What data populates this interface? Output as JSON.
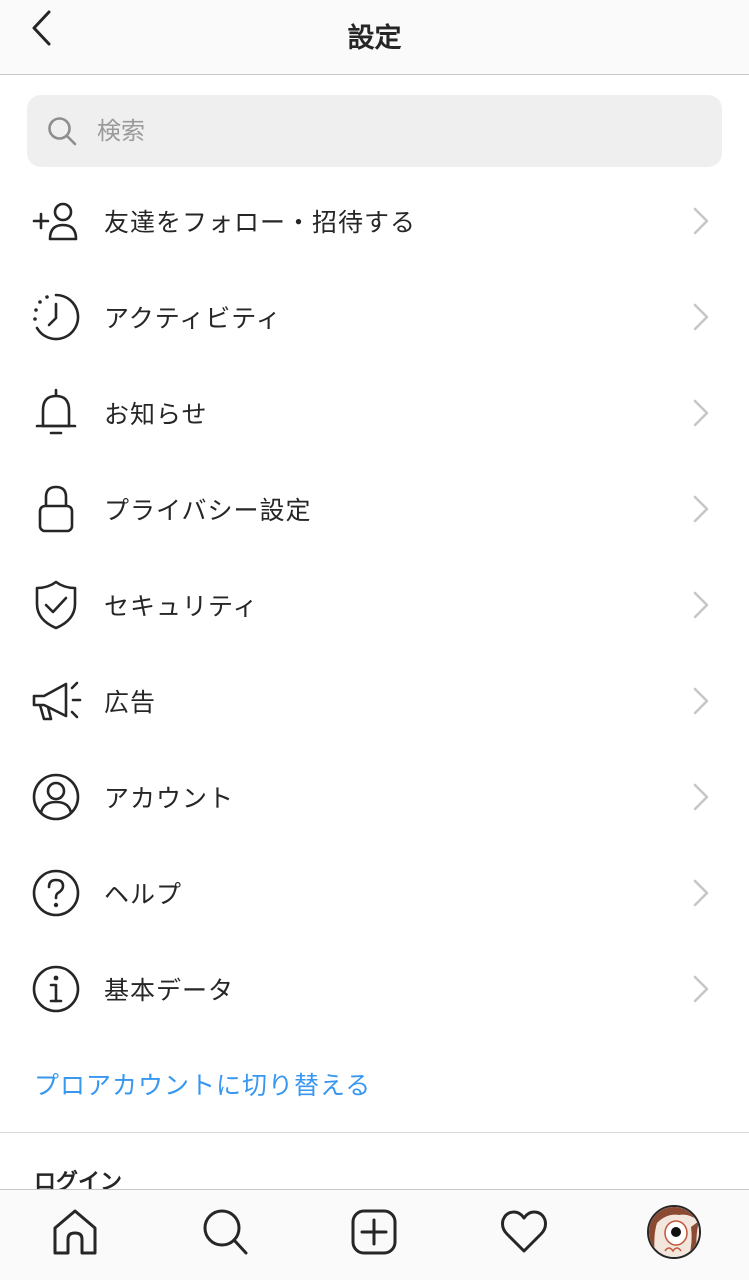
{
  "header": {
    "title": "設定",
    "back_icon": "chevron-left-icon"
  },
  "search": {
    "placeholder": "検索",
    "value": "",
    "icon": "search-icon"
  },
  "menu": [
    {
      "label": "友達をフォロー・招待する",
      "icon": "add-person-icon"
    },
    {
      "label": "アクティビティ",
      "icon": "activity-clock-icon"
    },
    {
      "label": "お知らせ",
      "icon": "bell-icon"
    },
    {
      "label": "プライバシー設定",
      "icon": "lock-icon"
    },
    {
      "label": "セキュリティ",
      "icon": "shield-check-icon"
    },
    {
      "label": "広告",
      "icon": "megaphone-icon"
    },
    {
      "label": "アカウント",
      "icon": "account-circle-icon"
    },
    {
      "label": "ヘルプ",
      "icon": "help-icon"
    },
    {
      "label": "基本データ",
      "icon": "info-icon"
    }
  ],
  "pro_link": "プロアカウントに切り替える",
  "login_section": {
    "heading": "ログイン"
  },
  "tabbar": {
    "items": [
      "home-icon",
      "search-icon",
      "new-post-icon",
      "heart-icon",
      "profile-avatar"
    ]
  },
  "colors": {
    "accent": "#3897f0",
    "text": "#262626",
    "chevron": "#c7c7c7",
    "search_bg": "#efefef"
  }
}
